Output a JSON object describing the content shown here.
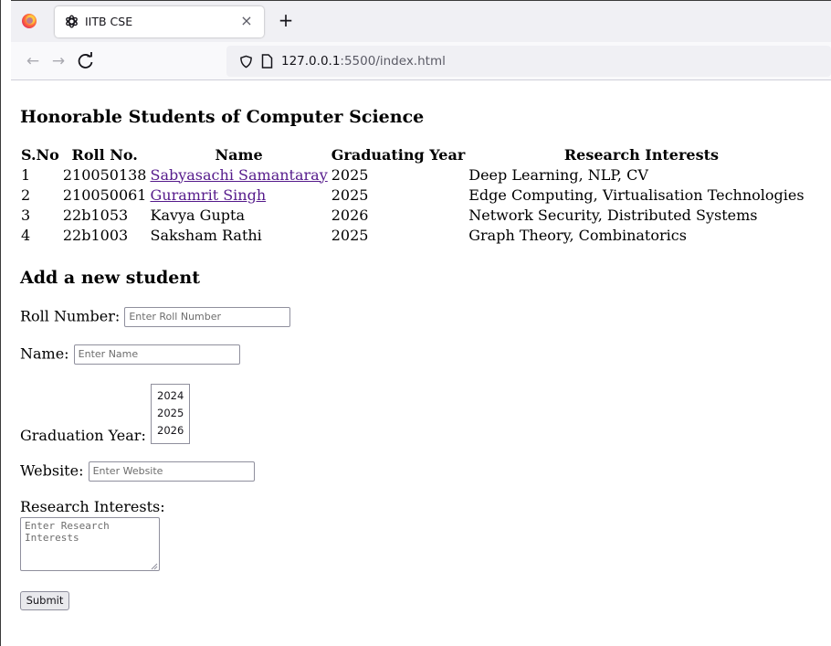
{
  "browser": {
    "tab_title": "IITB CSE",
    "tab_close_glyph": "×",
    "new_tab_glyph": "+",
    "back_glyph": "←",
    "forward_glyph": "→",
    "reload_glyph": "C",
    "url_host": "127.0.0.1",
    "url_rest": ":5500/index.html"
  },
  "page": {
    "title": "Honorable Students of Computer Science",
    "table": {
      "headers": [
        "S.No",
        "Roll No.",
        "Name",
        "Graduating Year",
        "Research Interests"
      ],
      "rows": [
        {
          "sno": "1",
          "roll": "210050138",
          "name": "Sabyasachi Samantaray",
          "linked": true,
          "year": "2025",
          "interests": "Deep Learning, NLP, CV"
        },
        {
          "sno": "2",
          "roll": "210050061",
          "name": "Guramrit Singh",
          "linked": true,
          "year": "2025",
          "interests": "Edge Computing, Virtualisation Technologies"
        },
        {
          "sno": "3",
          "roll": "22b1053",
          "name": "Kavya Gupta",
          "linked": false,
          "year": "2026",
          "interests": "Network Security, Distributed Systems"
        },
        {
          "sno": "4",
          "roll": "22b1003",
          "name": "Saksham Rathi",
          "linked": false,
          "year": "2025",
          "interests": "Graph Theory, Combinatorics"
        }
      ]
    },
    "form": {
      "title": "Add a new student",
      "roll_label": "Roll Number:",
      "roll_placeholder": "Enter Roll Number",
      "name_label": "Name:",
      "name_placeholder": "Enter Name",
      "year_label": "Graduation Year:",
      "year_options": [
        "2024",
        "2025",
        "2026"
      ],
      "website_label": "Website:",
      "website_placeholder": "Enter Website",
      "interests_label": "Research Interests:",
      "interests_placeholder": "Enter Research\nInterests",
      "submit_label": "Submit"
    }
  },
  "colors": {
    "link_visited": "#551a8b",
    "tabstrip_bg": "#f0f0f4",
    "navbar_bg": "#f9f9fb"
  }
}
